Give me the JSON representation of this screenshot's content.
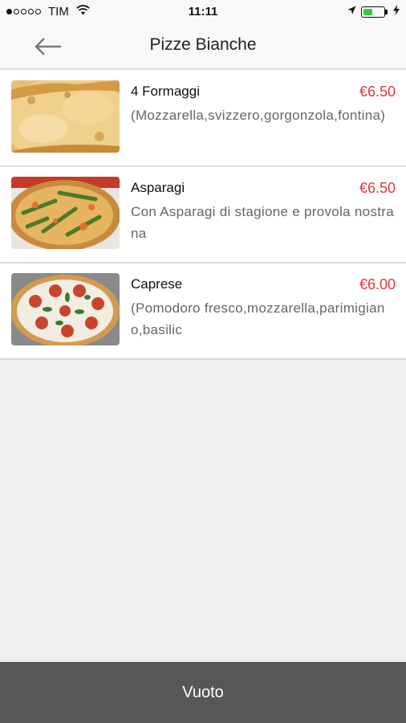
{
  "status_bar": {
    "carrier": "TIM",
    "time": "11:11",
    "battery_level_percent": 45,
    "battery_color": "#3ec63e"
  },
  "nav": {
    "back_icon": "arrow-left-icon",
    "title": "Pizze Bianche"
  },
  "items": [
    {
      "name": "4 Formaggi",
      "price": "€6.50",
      "description": "(Mozzarella,svizzero,gorgonzola,fontina)"
    },
    {
      "name": "Asparagi",
      "price": "€6.50",
      "description": "Con Asparagi di stagione e provola nostrana"
    },
    {
      "name": "Caprese",
      "price": "€6.00",
      "description": "(Pomodoro fresco,mozzarella,parimigiano,basilic"
    }
  ],
  "bottom_bar": {
    "label": "Vuoto"
  },
  "colors": {
    "price": "#e4373a",
    "bottom_bar": "#575757",
    "background": "#efefef"
  }
}
